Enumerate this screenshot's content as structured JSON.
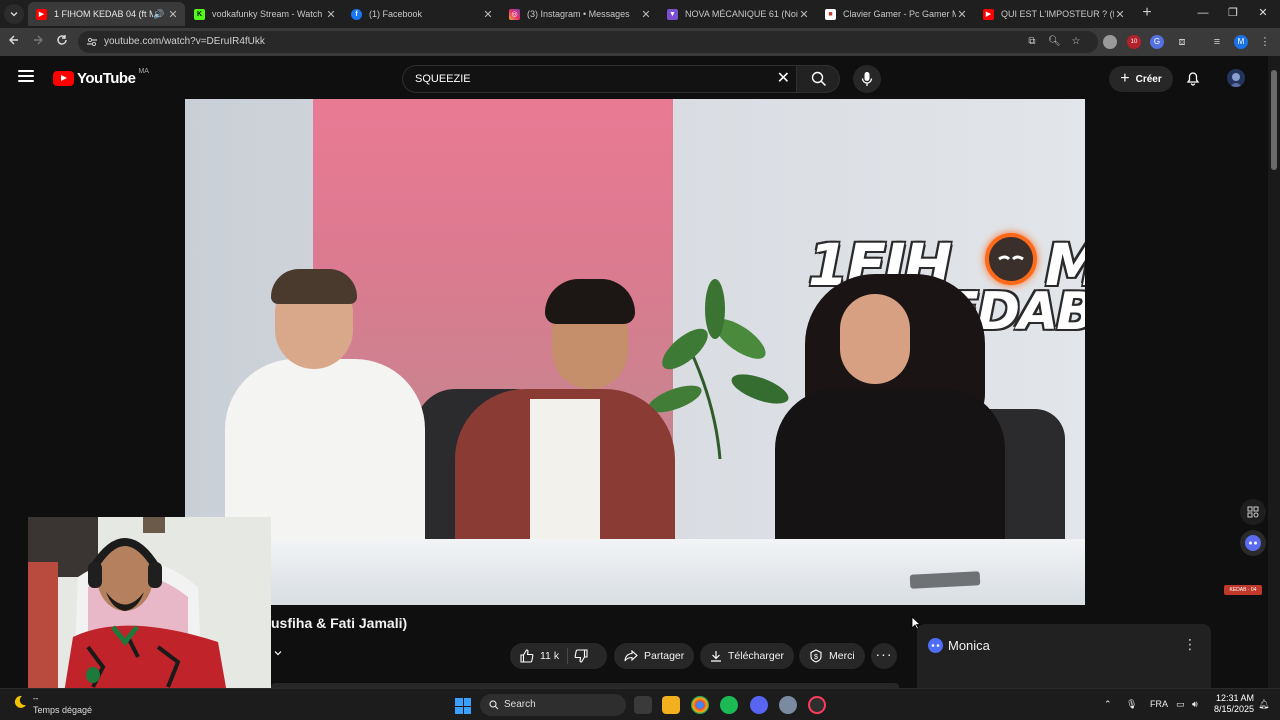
{
  "browser": {
    "tabs": [
      {
        "title": "1 FIHOM KEDAB 04 (ft Mon",
        "favicon": "youtube-favicon",
        "color": "#ff0000",
        "active": true
      },
      {
        "title": "vodkafunky Stream - Watch Liv",
        "favicon": "kick-favicon",
        "color": "#53fc18"
      },
      {
        "title": "(1) Facebook",
        "favicon": "facebook-favicon",
        "color": "#1877f2"
      },
      {
        "title": "(3) Instagram • Messages",
        "favicon": "instagram-favicon",
        "color": "#e1306c"
      },
      {
        "title": "NOVA MÉCANIQUE 61 (Noir) -",
        "favicon": "nova-favicon",
        "color": "#7a4fd0"
      },
      {
        "title": "Clavier Gamer - Pc Gamer Mar",
        "favicon": "shop-favicon",
        "color": "#c0392b"
      },
      {
        "title": "QUI EST L'IMPOSTEUR ? (ft Eric",
        "favicon": "youtube-favicon",
        "color": "#ff0000"
      }
    ],
    "new_tab_label": "+",
    "url": "youtube.com/watch?v=DEruIR4fUkk"
  },
  "youtube": {
    "logo_text": "YouTube",
    "country_code": "MA",
    "search_query": "SQUEEZIE",
    "create_label": "Créer"
  },
  "video": {
    "thumbnail_text_line1": "1FIH",
    "thumbnail_text_m": "M",
    "thumbnail_text_line2": "KEDAB!",
    "title_visible": "usfiha & Fati Jamali)",
    "like_count": "11 k",
    "share_label": "Partager",
    "download_label": "Télécharger",
    "thanks_label": "Merci",
    "badge_text": "KEDAB · 04"
  },
  "monica": {
    "name": "Monica"
  },
  "taskbar": {
    "weather_temp": "--",
    "weather_condition": "Temps dégagé",
    "search_label": "Search",
    "language": "FRA",
    "time": "12:31 AM",
    "date": "8/15/2025"
  },
  "colors": {
    "yt_red": "#ff0000",
    "bg": "#0f0f0f",
    "chip": "#272727",
    "accent_blue": "#3aa0ff"
  }
}
